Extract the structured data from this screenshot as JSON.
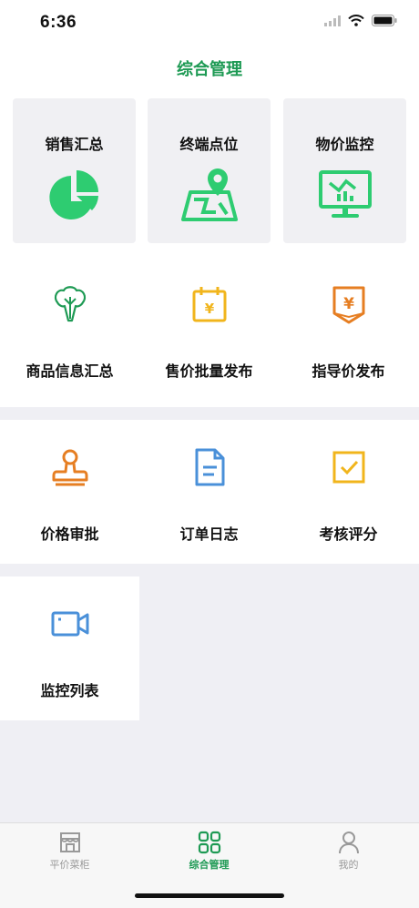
{
  "status_bar": {
    "time": "6:36",
    "icons": [
      "signal-icon",
      "wifi-icon",
      "battery-icon"
    ]
  },
  "nav": {
    "title": "综合管理"
  },
  "top_cards": [
    {
      "label": "销售汇总",
      "icon": "pie-chart-icon"
    },
    {
      "label": "终端点位",
      "icon": "map-location-icon"
    },
    {
      "label": "物价监控",
      "icon": "monitor-chart-icon"
    }
  ],
  "grid_rows": [
    [
      {
        "label": "商品信息汇总",
        "icon": "vegetable-icon"
      },
      {
        "label": "售价批量发布",
        "icon": "price-calendar-icon"
      },
      {
        "label": "指导价发布",
        "icon": "price-tag-icon"
      }
    ],
    [
      {
        "label": "价格审批",
        "icon": "stamp-icon"
      },
      {
        "label": "订单日志",
        "icon": "document-icon"
      },
      {
        "label": "考核评分",
        "icon": "checkbox-icon"
      }
    ],
    [
      {
        "label": "监控列表",
        "icon": "video-camera-icon"
      }
    ]
  ],
  "tab_bar": {
    "items": [
      {
        "label": "平价菜柜",
        "icon": "store-icon",
        "active": false
      },
      {
        "label": "综合管理",
        "icon": "grid-icon",
        "active": true
      },
      {
        "label": "我的",
        "icon": "user-icon",
        "active": false
      }
    ]
  },
  "colors": {
    "accent_green": "#1e9a54",
    "icon_green": "#2ecc71",
    "orange": "#e67e22",
    "yellow": "#f1b51c",
    "blue": "#4a90d9"
  }
}
